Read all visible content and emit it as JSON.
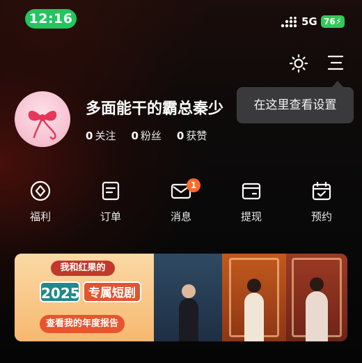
{
  "status_bar": {
    "time": "12:16",
    "network": "5G",
    "battery": "76"
  },
  "colors": {
    "time_pill": "#22c55e",
    "badge": "#ff6a2a",
    "tooltip_bg": "#3a3a3c"
  },
  "icons": {
    "theme": "sun-icon",
    "menu": "menu-icon"
  },
  "tooltip": {
    "text": "在这里查看设置"
  },
  "profile": {
    "username": "多面能干的霸总秦少",
    "stats": [
      {
        "value": "0",
        "label": "关注"
      },
      {
        "value": "0",
        "label": "粉丝"
      },
      {
        "value": "0",
        "label": "获赞"
      }
    ]
  },
  "shortcuts": [
    {
      "label": "福利",
      "icon": "gift-diamond-icon"
    },
    {
      "label": "订单",
      "icon": "order-icon"
    },
    {
      "label": "消息",
      "icon": "mail-icon",
      "badge": "1"
    },
    {
      "label": "提现",
      "icon": "wallet-icon"
    },
    {
      "label": "预约",
      "icon": "calendar-icon"
    }
  ],
  "banner": {
    "top_text": "我和红果的",
    "year": "2025",
    "title": "专属短剧",
    "cta": "查看我的年度报告"
  }
}
